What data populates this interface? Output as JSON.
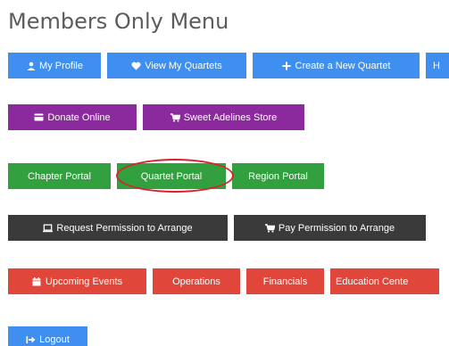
{
  "heading": "Members Only Menu",
  "colors": {
    "blue": "#3f8ff0",
    "purple": "#8a2a9c",
    "green": "#33a040",
    "dark": "#3a3a3a",
    "red": "#e0463a",
    "circle": "#d8232a"
  },
  "rows": {
    "profile": {
      "my_profile": {
        "label": "My Profile",
        "icon": "user-icon"
      },
      "view_quartets": {
        "label": "View My Quartets",
        "icon": "heart-icon"
      },
      "create_quartet": {
        "label": "Create a New Quartet",
        "icon": "plus-icon"
      },
      "truncated": {
        "label": "H"
      }
    },
    "shop": {
      "donate": {
        "label": "Donate Online",
        "icon": "credit-card-icon"
      },
      "store": {
        "label": "Sweet Adelines Store",
        "icon": "shopping-cart-icon"
      }
    },
    "portals": {
      "chapter": {
        "label": "Chapter Portal"
      },
      "quartet": {
        "label": "Quartet Portal"
      },
      "region": {
        "label": "Region Portal"
      }
    },
    "arrange": {
      "request": {
        "label": "Request Permission to Arrange",
        "icon": "laptop-icon"
      },
      "pay": {
        "label": "Pay Permission to Arrange",
        "icon": "shopping-cart-icon"
      }
    },
    "info": {
      "events": {
        "label": "Upcoming Events",
        "icon": "calendar-icon"
      },
      "operations": {
        "label": "Operations"
      },
      "financials": {
        "label": "Financials"
      },
      "education": {
        "label": "Education Cente"
      }
    },
    "account": {
      "logout": {
        "label": "Logout",
        "icon": "sign-out-icon"
      }
    }
  }
}
